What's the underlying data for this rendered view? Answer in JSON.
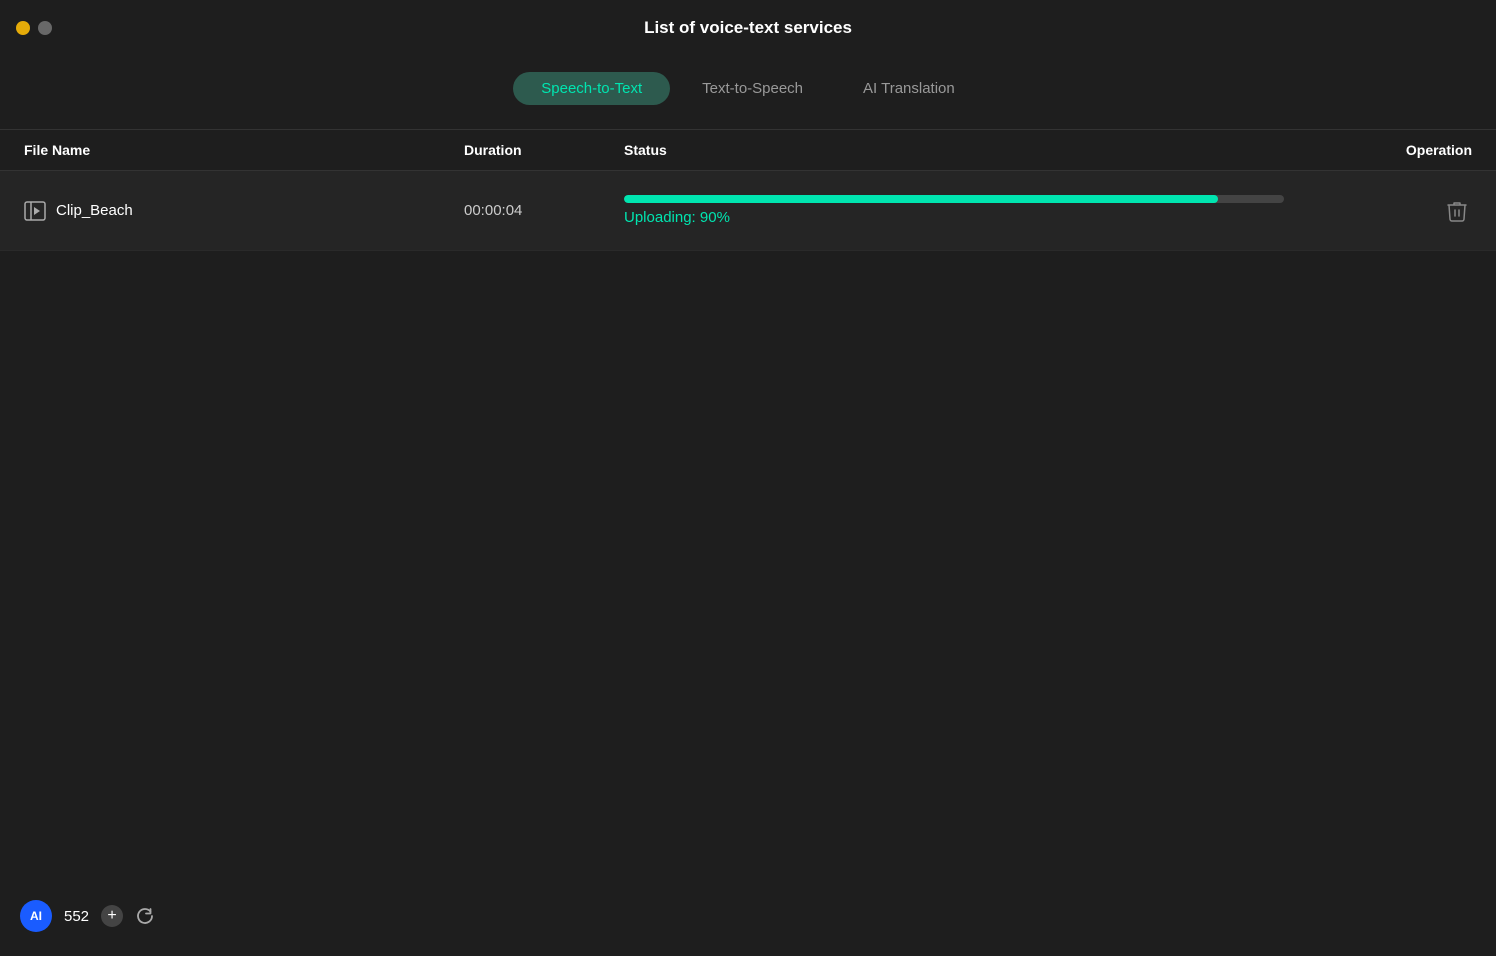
{
  "window": {
    "title": "List of voice-text services",
    "controls": {
      "close_label": "",
      "minimize_label": ""
    }
  },
  "tabs": [
    {
      "id": "speech-to-text",
      "label": "Speech-to-Text",
      "active": true
    },
    {
      "id": "text-to-speech",
      "label": "Text-to-Speech",
      "active": false
    },
    {
      "id": "ai-translation",
      "label": "AI Translation",
      "active": false
    }
  ],
  "table": {
    "headers": {
      "filename": "File Name",
      "duration": "Duration",
      "status": "Status",
      "operation": "Operation"
    },
    "rows": [
      {
        "filename": "Clip_Beach",
        "duration": "00:00:04",
        "status_text": "Uploading:  90%",
        "progress": 90,
        "progress_color": "#00e5b0"
      }
    ]
  },
  "bottom_bar": {
    "ai_label": "AI",
    "credit_count": "552",
    "add_label": "+",
    "refresh_label": "↻"
  },
  "colors": {
    "active_tab_bg": "#2d5a4e",
    "active_tab_text": "#00e5b0",
    "progress_fill": "#00e5b0",
    "status_text": "#00e5b0",
    "ai_badge_bg": "#1a5cff"
  }
}
